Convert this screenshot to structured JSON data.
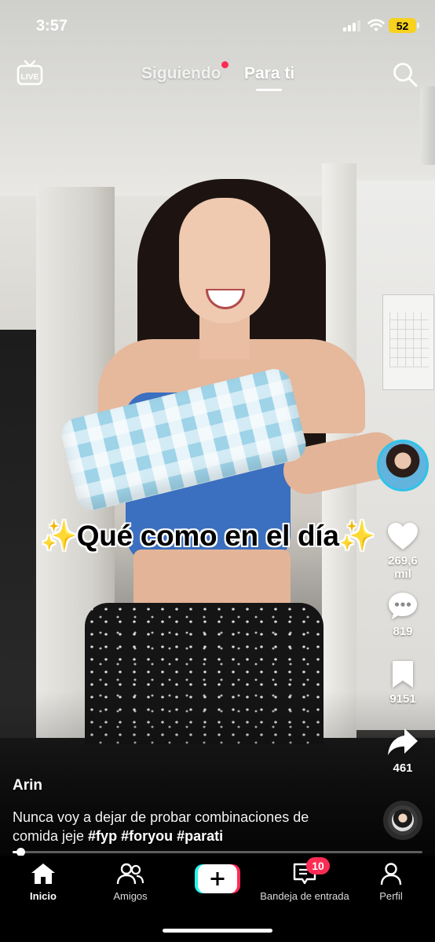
{
  "status_bar": {
    "time": "3:57",
    "battery": "52"
  },
  "top_nav": {
    "live_label": "LIVE",
    "tabs": [
      {
        "label": "Siguiendo",
        "active": false,
        "has_dot": true
      },
      {
        "label": "Para ti",
        "active": true
      }
    ]
  },
  "video": {
    "caption_text": "✨Qué como en el día✨"
  },
  "right_rail": {
    "likes": "269,6 mil",
    "comments": "819",
    "saves": "9151",
    "shares": "461"
  },
  "post": {
    "author": "Arin",
    "description_text": "Nunca voy a dejar de probar combinaciones de comida jeje ",
    "hashtags": [
      "#fyp",
      "#foryou",
      "#parati"
    ],
    "progress": 0.02
  },
  "bottom_nav": {
    "items": [
      {
        "label": "Inicio",
        "active": true
      },
      {
        "label": "Amigos",
        "active": false
      },
      {
        "label": "Bandeja de entrada",
        "active": false
      },
      {
        "label": "Perfil",
        "active": false
      }
    ],
    "inbox_badge": "10"
  },
  "colors": {
    "accent": "#fe2c55",
    "avatar_ring": "#2fc4e8",
    "battery": "#f7d21e"
  }
}
